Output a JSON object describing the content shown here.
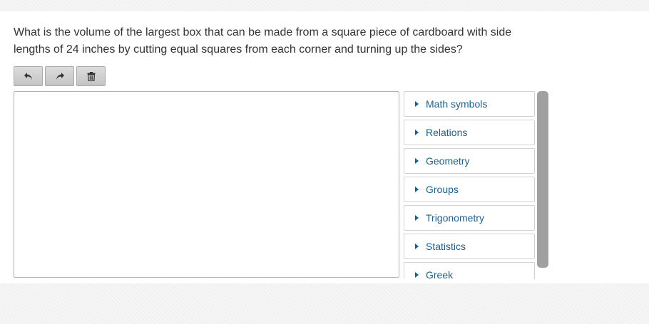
{
  "question": {
    "text": "What is the volume of the largest box that can be made from a square piece of cardboard with side lengths of 24 inches by cutting equal squares from each corner and turning up the sides?"
  },
  "toolbar": {
    "buttons": [
      {
        "icon": "undo-icon"
      },
      {
        "icon": "redo-icon"
      },
      {
        "icon": "trash-icon"
      }
    ]
  },
  "editor": {
    "value": ""
  },
  "palette": {
    "items": [
      {
        "label": "Math symbols"
      },
      {
        "label": "Relations"
      },
      {
        "label": "Geometry"
      },
      {
        "label": "Groups"
      },
      {
        "label": "Trigonometry"
      },
      {
        "label": "Statistics"
      },
      {
        "label": "Greek"
      }
    ]
  },
  "colors": {
    "link": "#1d5f8a",
    "text": "#333333",
    "scrollbar": "#a0a0a0"
  }
}
